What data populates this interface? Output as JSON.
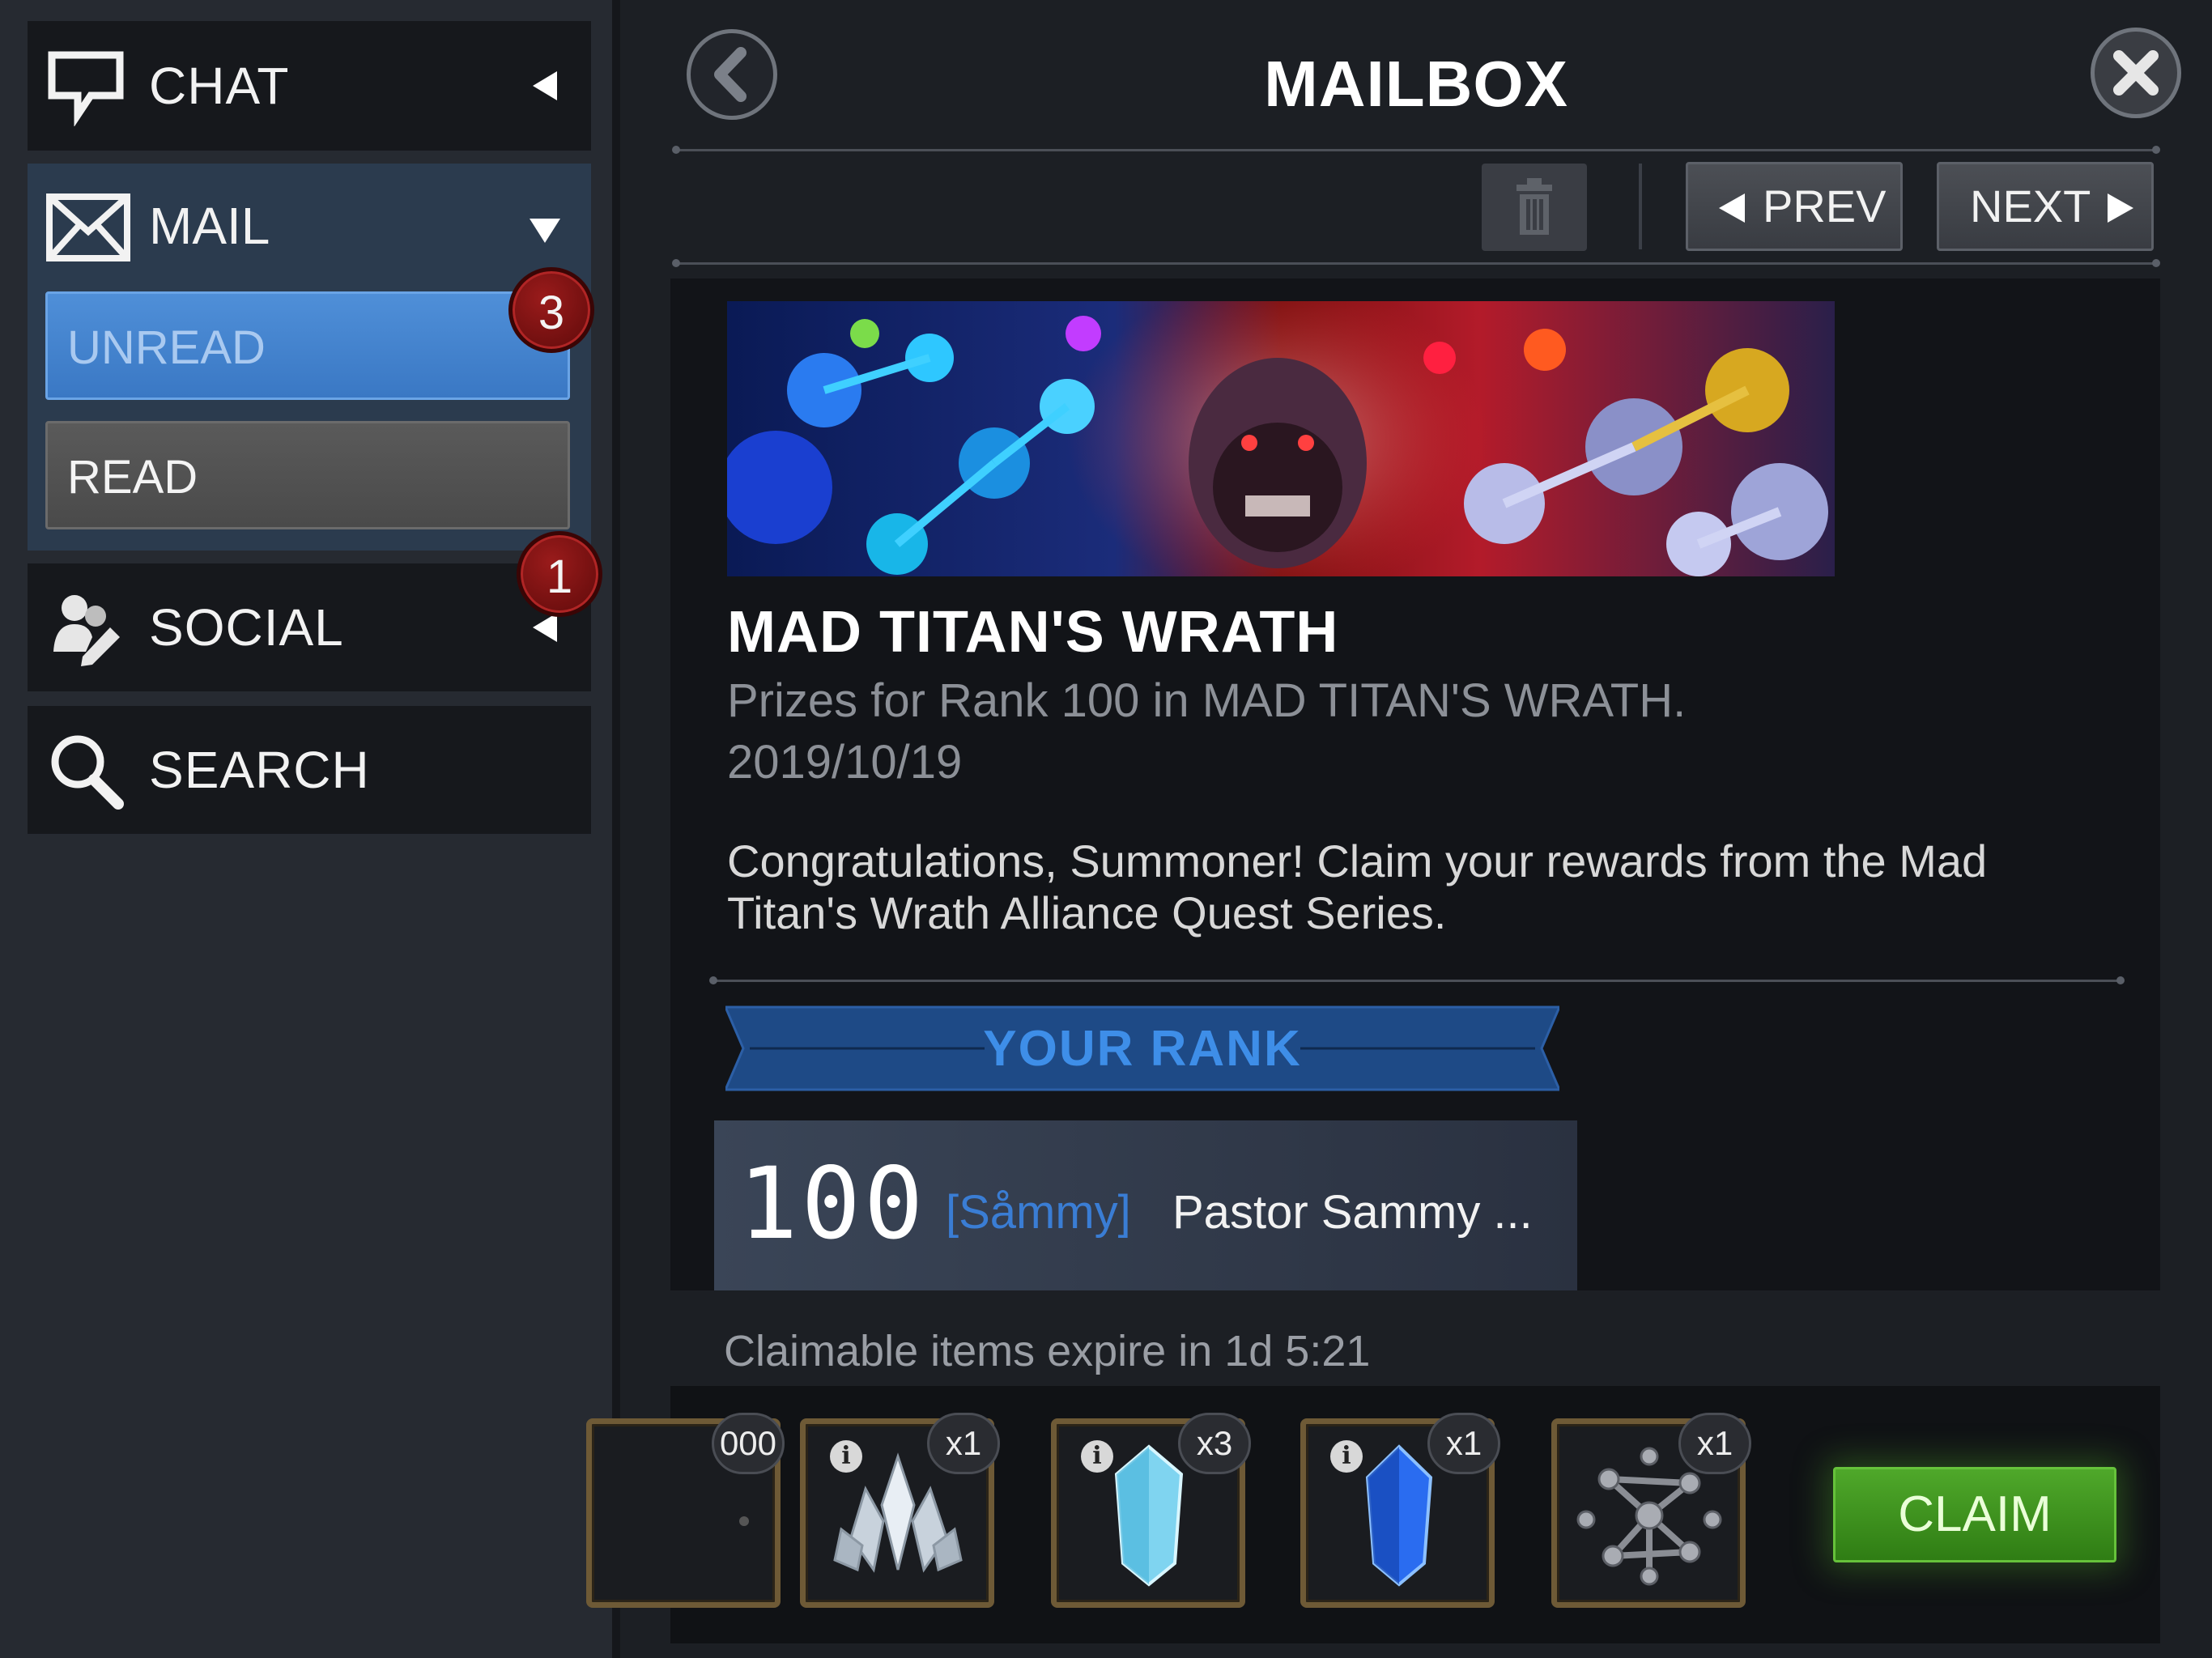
{
  "sidebar": {
    "chat": {
      "label": "CHAT",
      "icon": "chat-bubble-icon"
    },
    "mail": {
      "label": "MAIL",
      "icon": "envelope-icon",
      "unread": {
        "label": "UNREAD",
        "badge": "3"
      },
      "read": {
        "label": "READ"
      }
    },
    "social": {
      "label": "SOCIAL",
      "icon": "social-people-icon",
      "badge": "1"
    },
    "search": {
      "label": "SEARCH",
      "icon": "magnifier-icon"
    }
  },
  "header": {
    "title": "MAILBOX",
    "back_icon": "back-arrow-icon",
    "close_icon": "close-x-icon"
  },
  "toolbar": {
    "trash_icon": "trash-icon",
    "prev_label": "PREV",
    "next_label": "NEXT"
  },
  "message": {
    "title": "MAD TITAN'S WRATH",
    "subtitle": "Prizes for Rank 100 in MAD TITAN'S WRATH.",
    "date": "2019/10/19",
    "body": "Congratulations, Summoner! Claim your rewards from the Mad Titan's Wrath Alliance Quest Series.",
    "rank_label": "YOUR RANK",
    "rank": {
      "number": "100",
      "tag": "[Såmmy]",
      "name": "Pastor Sammy ..."
    }
  },
  "rewards": {
    "expire_text": "Claimable items expire in 1d 5:21",
    "items": [
      {
        "icon": "partial-item-icon",
        "qty": "000"
      },
      {
        "icon": "crystal-cluster-icon",
        "qty": "x1"
      },
      {
        "icon": "cyan-crystal-icon",
        "qty": "x3"
      },
      {
        "icon": "blue-crystal-icon",
        "qty": "x1"
      },
      {
        "icon": "molecule-icon",
        "qty": "x1"
      }
    ],
    "claim_label": "CLAIM"
  },
  "colors": {
    "unread_blue": "#3a78c4",
    "badge_red": "#8a1414",
    "claim_green": "#3f9420",
    "rank_blue": "#3e8ee8"
  }
}
